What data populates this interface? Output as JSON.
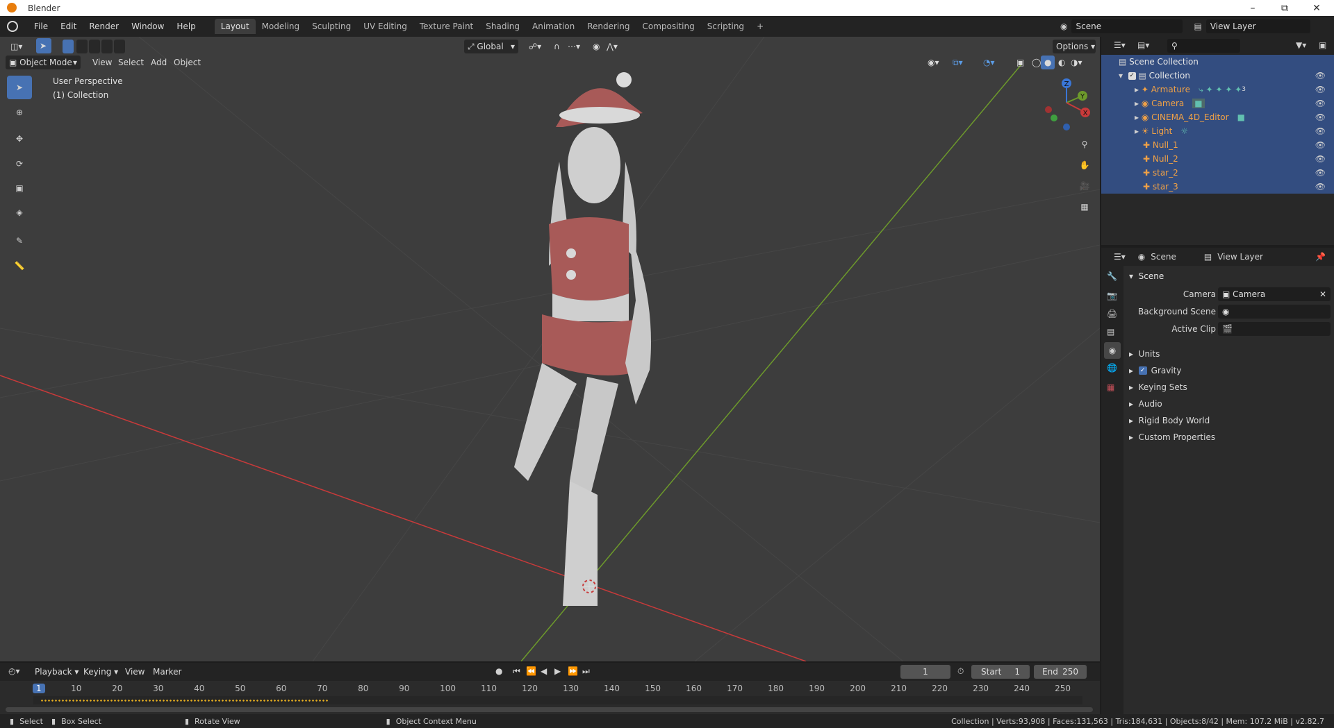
{
  "app": {
    "title": "Blender"
  },
  "topmenu": [
    "File",
    "Edit",
    "Render",
    "Window",
    "Help"
  ],
  "workspaces": [
    "Layout",
    "Modeling",
    "Sculpting",
    "UV Editing",
    "Texture Paint",
    "Shading",
    "Animation",
    "Rendering",
    "Compositing",
    "Scripting"
  ],
  "active_workspace": "Layout",
  "scene_field": "Scene",
  "viewlayer_field": "View Layer",
  "viewport": {
    "mode": "Object Mode",
    "menus": [
      "View",
      "Select",
      "Add",
      "Object"
    ],
    "orientation": "Global",
    "options_label": "Options",
    "perspective": "User Perspective",
    "collection_label": "(1) Collection",
    "gizmo": {
      "x": "X",
      "y": "Y",
      "z": "Z"
    }
  },
  "outliner": {
    "root": "Scene Collection",
    "collection": "Collection",
    "items": [
      "Armature",
      "Camera",
      "CINEMA_4D_Editor",
      "Light",
      "Null_1",
      "Null_2",
      "star_2",
      "star_3"
    ],
    "armature_badge": "3"
  },
  "properties": {
    "tab_scene": "Scene",
    "tab_viewlayer": "View Layer",
    "section": "Scene",
    "camera_label": "Camera",
    "camera_value": "Camera",
    "background_label": "Background Scene",
    "clip_label": "Active Clip",
    "panels": [
      "Units",
      "Gravity",
      "Keying Sets",
      "Audio",
      "Rigid Body World",
      "Custom Properties"
    ],
    "gravity_checked": true
  },
  "timeline": {
    "menus": [
      "Playback",
      "Keying",
      "View",
      "Marker"
    ],
    "current_frame": "1",
    "start_label": "Start",
    "start": "1",
    "end_label": "End",
    "end": "250",
    "ticks": [
      "1",
      "10",
      "20",
      "30",
      "40",
      "50",
      "60",
      "70",
      "80",
      "90",
      "100",
      "110",
      "120",
      "130",
      "140",
      "150",
      "160",
      "170",
      "180",
      "190",
      "200",
      "210",
      "220",
      "230",
      "240",
      "250"
    ]
  },
  "status": {
    "select": "Select",
    "box_select": "Box Select",
    "rotate": "Rotate View",
    "context": "Object Context Menu",
    "stats": "Collection | Verts:93,908 | Faces:131,563 | Tris:184,631 | Objects:8/42 | Mem: 107.2 MiB | v2.82.7"
  },
  "colors": {
    "accent": "#4772b3",
    "selection_orange": "#f0a146",
    "viewport_bg": "#3d3d3d",
    "x_axis": "#c83a3a",
    "y_axis": "#6d9a2b"
  }
}
